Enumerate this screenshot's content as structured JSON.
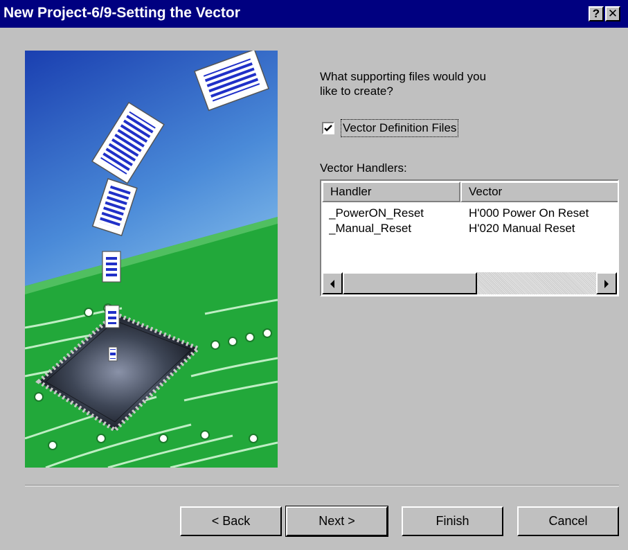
{
  "window": {
    "title": "New Project-6/9-Setting the Vector",
    "help_glyph": "?",
    "close_glyph": "✕"
  },
  "content": {
    "prompt_line1": "What supporting files would you",
    "prompt_line2": "like to create?",
    "checkbox_label": "Vector Definition Files",
    "checkbox_checked": true,
    "handlers_label": "Vector Handlers:"
  },
  "listview": {
    "columns": [
      "Handler",
      "Vector"
    ],
    "rows": [
      [
        "_PowerON_Reset",
        "H'000 Power On Reset"
      ],
      [
        "_Manual_Reset",
        "H'020 Manual Reset"
      ]
    ],
    "scroll_position": 0
  },
  "buttons": {
    "back": "< Back",
    "next": "Next >",
    "finish": "Finish",
    "cancel": "Cancel"
  },
  "icons": {
    "left_arrow": "left-arrow-icon",
    "right_arrow": "right-arrow-icon",
    "checkmark": "checkmark-icon"
  }
}
